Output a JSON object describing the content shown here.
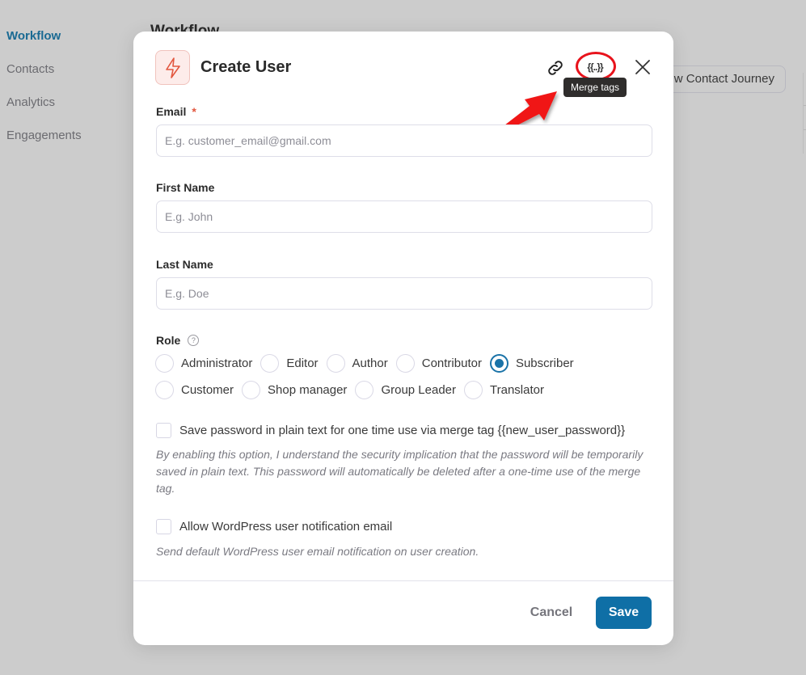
{
  "background": {
    "sidebar": {
      "items": [
        {
          "label": "Workflow",
          "active": true
        },
        {
          "label": "Contacts",
          "active": false
        },
        {
          "label": "Analytics",
          "active": false
        },
        {
          "label": "Engagements",
          "active": false
        }
      ]
    },
    "page_title": "Workflow",
    "journey_button": "View Contact Journey"
  },
  "modal": {
    "title": "Create User",
    "header_icon": "lightning-bolt-icon",
    "actions": {
      "link_icon": "link-icon",
      "merge_tags_icon_text": "{{..}}",
      "merge_tags_tooltip": "Merge tags",
      "close_icon": "close-icon"
    },
    "fields": {
      "email": {
        "label": "Email",
        "required_mark": "*",
        "value": "",
        "placeholder": "E.g. customer_email@gmail.com"
      },
      "first_name": {
        "label": "First Name",
        "value": "",
        "placeholder": "E.g. John"
      },
      "last_name": {
        "label": "Last Name",
        "value": "",
        "placeholder": "E.g. Doe"
      }
    },
    "role": {
      "label": "Role",
      "help_icon": "?",
      "selected": "Subscriber",
      "options_row1": [
        "Administrator",
        "Editor",
        "Author",
        "Contributor",
        "Subscriber"
      ],
      "options_row2": [
        "Customer",
        "Shop manager",
        "Group Leader",
        "Translator"
      ]
    },
    "save_password": {
      "checked": false,
      "label": "Save password in plain text for one time use via merge tag {{new_user_password}}",
      "help": "By enabling this option, I understand the security implication that the password will be temporarily saved in plain text. This password will automatically be deleted after a one-time use of the merge tag."
    },
    "notification": {
      "checked": false,
      "label": "Allow WordPress user notification email",
      "help": "Send default WordPress user email notification on user creation."
    },
    "footer": {
      "cancel_label": "Cancel",
      "save_label": "Save"
    }
  },
  "annotation": {
    "highlight_color": "#e8131c",
    "target": "merge-tags-button"
  },
  "colors": {
    "primary": "#0f6fa6",
    "required": "#e2573f",
    "icon_accent": "#e2573f"
  }
}
